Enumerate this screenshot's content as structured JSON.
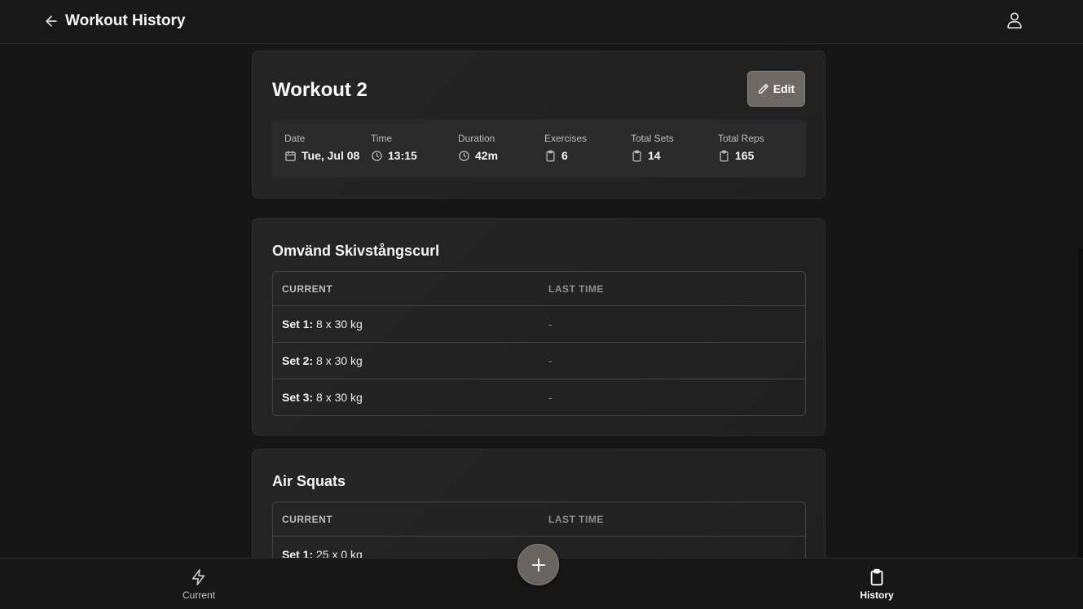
{
  "header": {
    "title": "Workout History",
    "back_icon": "arrow-left-icon",
    "profile_icon": "user-icon"
  },
  "summary": {
    "title": "Workout 2",
    "edit_label": "Edit",
    "stats": [
      {
        "label": "Date",
        "value": "Tue, Jul 08",
        "icon": "calendar-icon"
      },
      {
        "label": "Time",
        "value": "13:15",
        "icon": "clock-icon"
      },
      {
        "label": "Duration",
        "value": "42m",
        "icon": "clock-icon"
      },
      {
        "label": "Exercises",
        "value": "6",
        "icon": "clipboard-icon"
      },
      {
        "label": "Total Sets",
        "value": "14",
        "icon": "clipboard-icon"
      },
      {
        "label": "Total Reps",
        "value": "165",
        "icon": "clipboard-icon"
      }
    ]
  },
  "exercises": [
    {
      "name": "Omvänd Skivstångscurl",
      "col_current": "CURRENT",
      "col_last": "LAST TIME",
      "sets": [
        {
          "label": "Set 1:",
          "value": "8 x 30 kg",
          "last": "-"
        },
        {
          "label": "Set 2:",
          "value": "8 x 30 kg",
          "last": "-"
        },
        {
          "label": "Set 3:",
          "value": "8 x 30 kg",
          "last": "-"
        }
      ]
    },
    {
      "name": "Air Squats",
      "col_current": "CURRENT",
      "col_last": "LAST TIME",
      "sets": [
        {
          "label": "Set 1:",
          "value": "25 x 0 kg",
          "last": ""
        }
      ]
    }
  ],
  "nav": {
    "current_label": "Current",
    "history_label": "History",
    "current_icon": "lightning-icon",
    "history_icon": "clipboard-icon",
    "add_icon": "plus-icon"
  },
  "colors": {
    "background": "#161616",
    "card": "#232323",
    "accent": "#6e6863"
  }
}
